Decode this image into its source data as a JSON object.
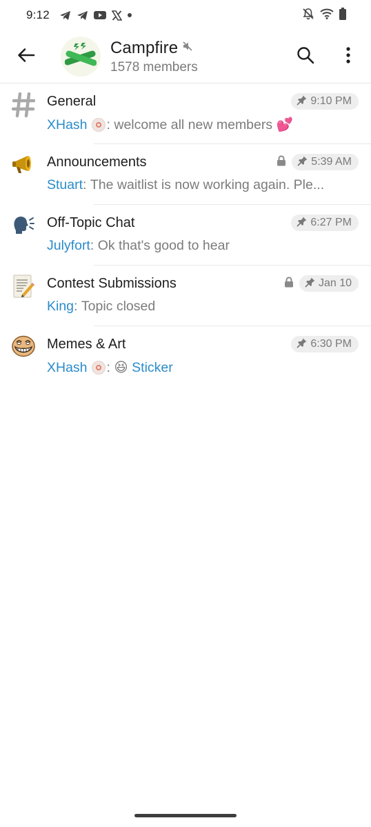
{
  "status_bar": {
    "time": "9:12",
    "left_icons": [
      "telegram-icon",
      "telegram-icon",
      "youtube-icon",
      "x-icon",
      "dot-icon"
    ],
    "right_icons": [
      "bell-off-icon",
      "wifi-icon",
      "battery-icon"
    ]
  },
  "header": {
    "title": "Campfire",
    "members": "1578 members",
    "muted": true,
    "avatar_icon": "campfire-logs-icon"
  },
  "topics": [
    {
      "icon": "hash-icon",
      "title": "General",
      "locked": false,
      "pinned": true,
      "time": "9:10 PM",
      "sender": "XHash",
      "sender_badge": true,
      "message": "welcome all new members 💕",
      "message_is_link": false
    },
    {
      "icon": "megaphone-icon",
      "title": "Announcements",
      "locked": true,
      "pinned": true,
      "time": "5:39 AM",
      "sender": "Stuart",
      "sender_badge": false,
      "message": "The waitlist is now working again. Ple...",
      "message_is_link": false
    },
    {
      "icon": "speaking-head-icon",
      "title": "Off-Topic Chat",
      "locked": false,
      "pinned": true,
      "time": "6:27 PM",
      "sender": "Julyfort",
      "sender_badge": false,
      "message": "Ok that's good to hear",
      "message_is_link": false
    },
    {
      "icon": "memo-icon",
      "title": "Contest Submissions",
      "locked": true,
      "pinned": true,
      "time": "Jan 10",
      "sender": "King",
      "sender_badge": false,
      "message": "Topic closed",
      "message_is_link": false
    },
    {
      "icon": "trollface-icon",
      "title": "Memes & Art",
      "locked": false,
      "pinned": true,
      "time": "6:30 PM",
      "sender": "XHash",
      "sender_badge": true,
      "message_emoji": "😆",
      "message": "Sticker",
      "message_is_link": true
    }
  ],
  "colors": {
    "accent": "#2a8bcb",
    "muted_text": "#7b7b7b",
    "pill_bg": "#eeeeee"
  }
}
